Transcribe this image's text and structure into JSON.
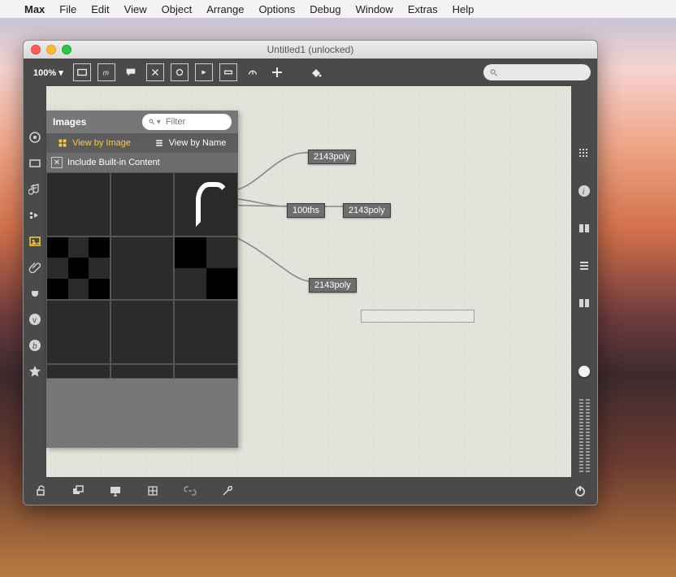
{
  "menubar": {
    "app": "Max",
    "items": [
      "File",
      "Edit",
      "View",
      "Object",
      "Arrange",
      "Options",
      "Debug",
      "Window",
      "Extras",
      "Help"
    ]
  },
  "window": {
    "title": "Untitled1 (unlocked)",
    "zoom": "100% ▾",
    "search_placeholder": ""
  },
  "panel": {
    "title": "Images",
    "filter_placeholder": "Filter",
    "tab_image": "View by Image",
    "tab_name": "View by Name",
    "include_label": "Include Built-in Content",
    "include_checked": true
  },
  "objects": {
    "b1": "2143poly",
    "b2": "100ths",
    "b3": "2143poly",
    "b4": "2143poly"
  }
}
